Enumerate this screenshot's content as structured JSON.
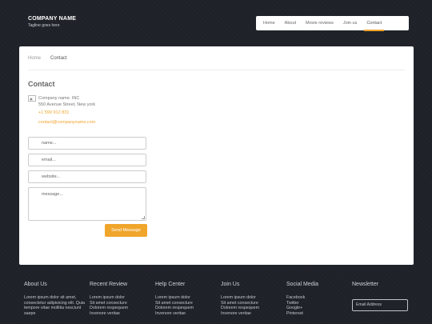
{
  "brand": {
    "name": "COMPANY NAME",
    "tagline": "Tagline goes here"
  },
  "nav": {
    "items": [
      "Home",
      "About",
      "Movie reviews",
      "Join us",
      "Contact"
    ],
    "active": "Contact"
  },
  "breadcrumb": {
    "home": "Home",
    "current": "Contact"
  },
  "contact": {
    "title": "Contact",
    "address_line1": "Company name. INC",
    "address_line2": "550 Avenue Street, New york",
    "phone": "+1 590 912 831",
    "email": "contact@companyname.com"
  },
  "form": {
    "name_placeholder": "name...",
    "email_placeholder": "email...",
    "website_placeholder": "website...",
    "message_placeholder": "message...",
    "send_label": "Send Message"
  },
  "footer": {
    "about": {
      "title": "About Us",
      "text": "Lorem ipsum dolor sit amet, consectetur adipisicing elit. Quia tempore vitae mollitia nesciunt saepe"
    },
    "recent": {
      "title": "Recent Review",
      "lines": [
        "Lorem ipsum dolor",
        "Sit amet consecture",
        "Dolorem respequem",
        "Invenore veritae"
      ]
    },
    "help": {
      "title": "Help Center",
      "lines": [
        "Lorem ipsum dolor",
        "Sit amet consecture",
        "Dolorem respequem",
        "Invenore veritae"
      ]
    },
    "join": {
      "title": "Join Us",
      "lines": [
        "Lorem ipsum dolor",
        "Sit amet consecture",
        "Dolorem respequem",
        "Invenore veritae"
      ]
    },
    "social": {
      "title": "Social Media",
      "links": [
        "Facebook",
        "Twitter",
        "Google+",
        "Pinterest"
      ]
    },
    "newsletter": {
      "title": "Newsletter",
      "placeholder": "Email Address"
    }
  },
  "colors": {
    "accent": "#f0a52b",
    "background": "#1e2228",
    "card": "#ffffff"
  }
}
